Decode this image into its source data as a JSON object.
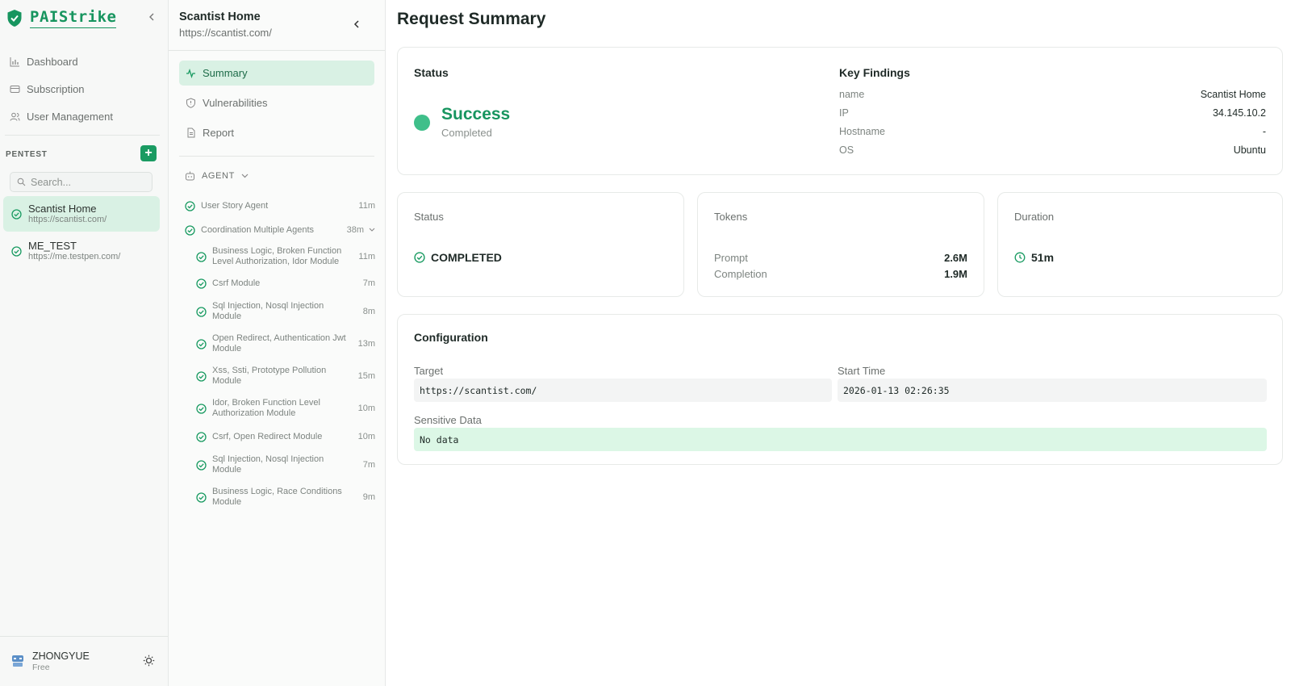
{
  "app": {
    "name": "PAIStrike"
  },
  "sidebar": {
    "nav": [
      {
        "label": "Dashboard",
        "icon": "bar-chart-icon"
      },
      {
        "label": "Subscription",
        "icon": "card-icon"
      },
      {
        "label": "User Management",
        "icon": "users-icon"
      }
    ],
    "section_label": "PENTEST",
    "add_label": "+",
    "search_placeholder": "Search...",
    "projects": [
      {
        "title": "Scantist Home",
        "url": "https://scantist.com/",
        "active": true
      },
      {
        "title": "ME_TEST",
        "url": "https://me.testpen.com/",
        "active": false
      }
    ],
    "user": {
      "name": "ZHONGYUE",
      "plan": "Free"
    }
  },
  "panel": {
    "title": "Scantist Home",
    "url": "https://scantist.com/",
    "tabs": [
      {
        "label": "Summary",
        "icon": "activity-icon",
        "active": true
      },
      {
        "label": "Vulnerabilities",
        "icon": "shield-icon",
        "active": false
      },
      {
        "label": "Report",
        "icon": "document-icon",
        "active": false
      }
    ],
    "agent_header": "AGENT",
    "agents": [
      {
        "label": "User Story Agent",
        "time": "11m"
      },
      {
        "label": "Coordination Multiple Agents",
        "time": "38m"
      }
    ],
    "sub_agents": [
      {
        "label": "Business Logic, Broken Function Level Authorization, Idor Module",
        "time": "11m"
      },
      {
        "label": "Csrf Module",
        "time": "7m"
      },
      {
        "label": "Sql Injection, Nosql Injection Module",
        "time": "8m"
      },
      {
        "label": "Open Redirect, Authentication Jwt Module",
        "time": "13m"
      },
      {
        "label": "Xss, Ssti, Prototype Pollution Module",
        "time": "15m"
      },
      {
        "label": "Idor, Broken Function Level Authorization Module",
        "time": "10m"
      },
      {
        "label": "Csrf, Open Redirect Module",
        "time": "10m"
      },
      {
        "label": "Sql Injection, Nosql Injection Module",
        "time": "7m"
      },
      {
        "label": "Business Logic, Race Conditions Module",
        "time": "9m"
      }
    ]
  },
  "main": {
    "title": "Request Summary",
    "status_card": {
      "heading": "Status",
      "state": "Success",
      "sub": "Completed"
    },
    "findings": {
      "heading": "Key Findings",
      "rows": [
        {
          "k": "name",
          "v": "Scantist Home"
        },
        {
          "k": "IP",
          "v": "34.145.10.2"
        },
        {
          "k": "Hostname",
          "v": "-"
        },
        {
          "k": "OS",
          "v": "Ubuntu"
        }
      ]
    },
    "stat_status": {
      "label": "Status",
      "value": "COMPLETED"
    },
    "stat_tokens": {
      "label": "Tokens",
      "prompt_label": "Prompt",
      "prompt_value": "2.6M",
      "completion_label": "Completion",
      "completion_value": "1.9M"
    },
    "stat_duration": {
      "label": "Duration",
      "value": "51m"
    },
    "config": {
      "heading": "Configuration",
      "target_label": "Target",
      "target_value": "https://scantist.com/",
      "start_label": "Start Time",
      "start_value": "2026-01-13 02:26:35",
      "sensitive_label": "Sensitive Data",
      "sensitive_value": "No data"
    }
  },
  "colors": {
    "accent": "#1a9b62",
    "success_dot": "#3fbf8a",
    "active_bg": "#d9f1e4",
    "sensitive_bg": "#dcf7e6"
  }
}
